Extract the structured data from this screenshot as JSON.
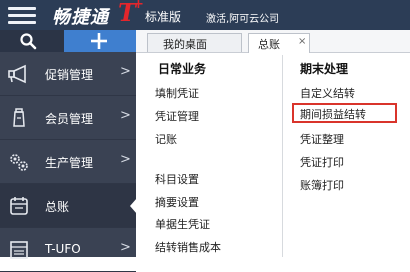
{
  "header": {
    "brand_name": "畅捷通",
    "brand_t": "T",
    "brand_plus": "+",
    "edition": "标准版",
    "activation": "激活,阿可云公司",
    "icons": {
      "menu": "hamburger-icon"
    }
  },
  "sidebar": {
    "tools": {
      "search_icon": "search-icon",
      "add_icon": "plus-icon"
    },
    "items": [
      {
        "label": "促销管理",
        "icon": "megaphone-icon",
        "chevron": ">"
      },
      {
        "label": "会员管理",
        "icon": "bottle-icon",
        "chevron": ">"
      },
      {
        "label": "生产管理",
        "icon": "gears-icon",
        "chevron": ">"
      },
      {
        "label": "总账",
        "icon": "ledger-icon",
        "chevron": ""
      },
      {
        "label": "T-UFO",
        "icon": "report-icon",
        "chevron": ">"
      }
    ]
  },
  "tabs": [
    {
      "label": "我的桌面"
    },
    {
      "label": "总账",
      "close": "×"
    }
  ],
  "content": {
    "daily": {
      "heading": "日常业务",
      "links": [
        "填制凭证",
        "凭证管理",
        "记账",
        "科目设置",
        "摘要设置",
        "单据生凭证",
        "结转销售成本"
      ]
    },
    "period_end": {
      "heading": "期末处理",
      "links": [
        "自定义结转",
        "期间损益结转",
        "凭证整理",
        "凭证打印",
        "账簿打印"
      ]
    }
  },
  "colors": {
    "topbar": "#2c3d56",
    "sidebar": "#3a4253",
    "accent_blue": "#3f7fcf",
    "brand_red": "#e3262c",
    "highlight": "#d9342b"
  }
}
